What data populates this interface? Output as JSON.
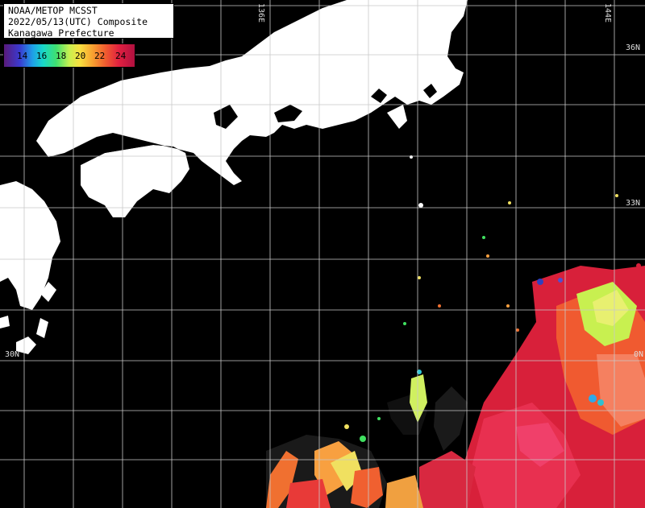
{
  "title": {
    "line1": "NOAA/METOP MCSST",
    "line2": "2022/05/13(UTC) Composite",
    "line3": "Kanagawa Prefecture"
  },
  "legend": {
    "ticks": [
      "14",
      "16",
      "18",
      "20",
      "22",
      "24"
    ]
  },
  "labels": {
    "lon_136": "136E",
    "lon_144": "144E",
    "lat_36": "36N",
    "lat_33": "33N",
    "lat_30": "30N",
    "lat_30_right": "0N"
  },
  "colors": {
    "land": "#ffffff",
    "sea_no_data": "#000000",
    "grid": "#c8c8c8"
  }
}
